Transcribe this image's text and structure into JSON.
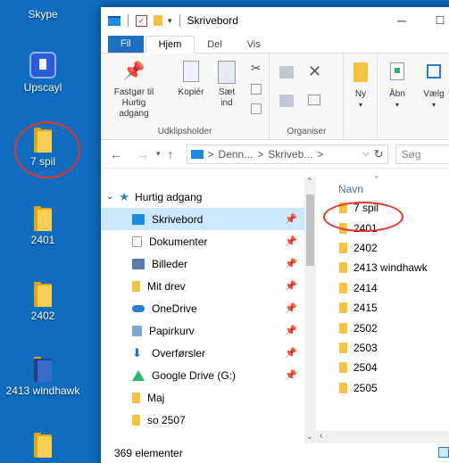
{
  "desktop": {
    "icons": [
      {
        "label": "Skype"
      },
      {
        "label": "Upscayl"
      },
      {
        "label": "7 spil"
      },
      {
        "label": "2401"
      },
      {
        "label": "2402"
      },
      {
        "label": "2413 windhawk"
      }
    ],
    "annotation_color": "#e5352b"
  },
  "window": {
    "title": "Skrivebord",
    "controls": {
      "minimize": "─",
      "maximize": "☐"
    },
    "ribbon_tabs": [
      "Fil",
      "Hjem",
      "Del",
      "Vis"
    ],
    "ribbon": {
      "clipboard": {
        "pin_label_1": "Fastgør til",
        "pin_label_2": "Hurtig adgang",
        "copy_label": "Kopiér",
        "paste_label_1": "Sæt",
        "paste_label_2": "ind",
        "group_label": "Udklipsholder"
      },
      "organize": {
        "group_label": "Organiser"
      },
      "new": {
        "new_label": "Ny"
      },
      "open": {
        "open_label": "Åbn",
        "select_label": "Vælg"
      }
    },
    "address": {
      "part1": "Denn...",
      "part2": "Skriveb...",
      "sep": ">"
    },
    "search_placeholder": "Søg",
    "nav": {
      "quick_access": "Hurtig adgang",
      "items": [
        {
          "label": "Skrivebord",
          "color": "#1e88e5"
        },
        {
          "label": "Dokumenter",
          "color": "#8a9bb4"
        },
        {
          "label": "Billeder",
          "color": "#5a7aa8"
        },
        {
          "label": "Mit drev",
          "color": "#f5c242"
        },
        {
          "label": "OneDrive",
          "color": "#2b7cd3"
        },
        {
          "label": "Papirkurv",
          "color": "#7aa7d4"
        },
        {
          "label": "Overførsler",
          "color": "#1f6fbe"
        },
        {
          "label": "Google Drive (G:)",
          "color": "#2bb673"
        },
        {
          "label": "Maj",
          "color": "#f5c242"
        },
        {
          "label": "so 2507",
          "color": "#f5c242"
        }
      ]
    },
    "files": {
      "column_header": "Navn",
      "items": [
        "7 spil",
        "2401",
        "2402",
        "2413 windhawk",
        "2414",
        "2415",
        "2502",
        "2503",
        "2504",
        "2505"
      ]
    },
    "status": "369 elementer",
    "accent": "#1f6fbe",
    "selected_bg": "#cce8ff"
  }
}
